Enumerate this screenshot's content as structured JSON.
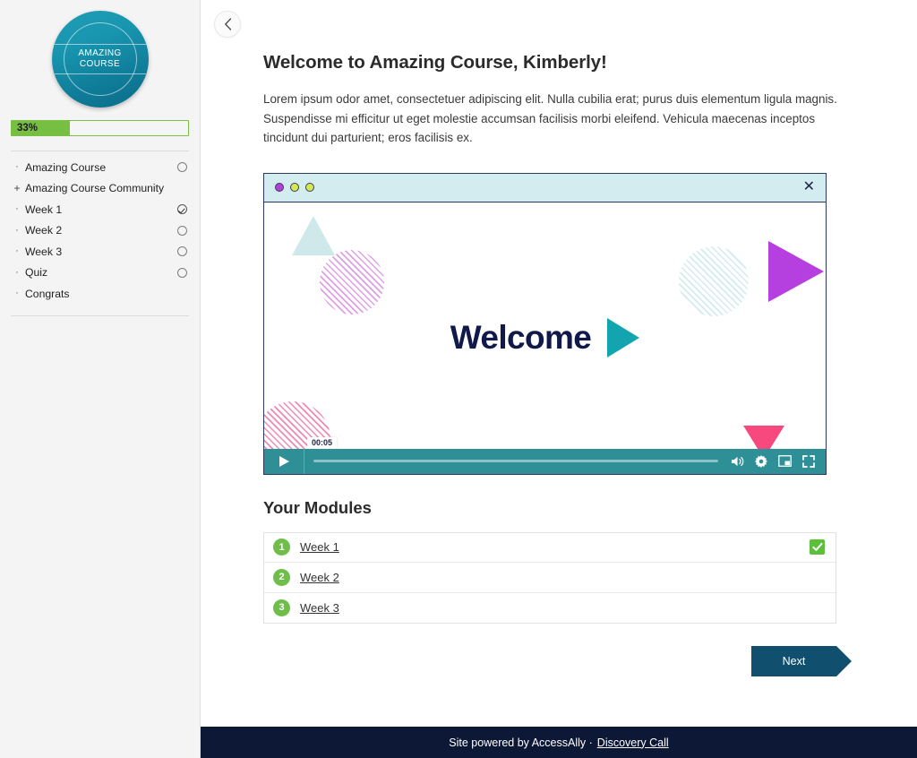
{
  "sidebar": {
    "logo": {
      "line1": "AMAZING",
      "line2": "COURSE"
    },
    "progress": {
      "percent_label": "33%",
      "percent_value": 33,
      "fill_color": "#76bf43"
    },
    "nav_items": [
      {
        "bullet": "·",
        "label": "Amazing Course",
        "status": "circle"
      },
      {
        "bullet": "+",
        "label": "Amazing Course Community",
        "status": "none"
      },
      {
        "bullet": "·",
        "label": "Week 1",
        "status": "check"
      },
      {
        "bullet": "·",
        "label": "Week 2",
        "status": "circle"
      },
      {
        "bullet": "·",
        "label": "Week 3",
        "status": "circle"
      },
      {
        "bullet": "·",
        "label": "Quiz",
        "status": "circle"
      },
      {
        "bullet": "·",
        "label": "Congrats",
        "status": "none"
      }
    ]
  },
  "main": {
    "back_button_icon": "chevron-left-icon",
    "title": "Welcome to Amazing Course, Kimberly!",
    "paragraph": "Lorem ipsum odor amet, consectetuer adipiscing elit. Nulla cubilia erat; purus duis elementum ligula magnis. Suspendisse mi efficitur ut eget molestie accumsan facilisis morbi eleifend. Vehicula maecenas inceptos tincidunt dui parturient; eros facilisis ex."
  },
  "video": {
    "window_dots": [
      "purple",
      "yellow-green",
      "yellow-green"
    ],
    "close_icon": "✕",
    "slide_text": "Welcome",
    "play_icon": "play-triangle-icon",
    "time_tooltip": "00:05",
    "controls": {
      "play_label": "play-button",
      "volume_icon": "volume-icon",
      "settings_icon": "gear-icon",
      "pip_icon": "picture-in-picture-icon",
      "fullscreen_icon": "fullscreen-icon"
    },
    "accent_colors": {
      "bar_bg": "#d3ecf0",
      "border": "#2b3a5c",
      "controls_bg": "#2e8f96",
      "welcome_navy": "#10194a",
      "teal": "#12a5b0",
      "purple": "#b63fe0",
      "magenta": "#f7497e"
    }
  },
  "modules": {
    "heading": "Your Modules",
    "rows": [
      {
        "number": "1",
        "label": "Week 1",
        "state": "done"
      },
      {
        "number": "2",
        "label": "Week 2",
        "state": "todo"
      },
      {
        "number": "3",
        "label": "Week 3",
        "state": "todo"
      }
    ],
    "next_label": "Next",
    "next_color": "#104f6e"
  },
  "footer": {
    "text": "Site powered by AccessAlly ·",
    "link": "Discovery Call",
    "bg": "#0c1836"
  }
}
